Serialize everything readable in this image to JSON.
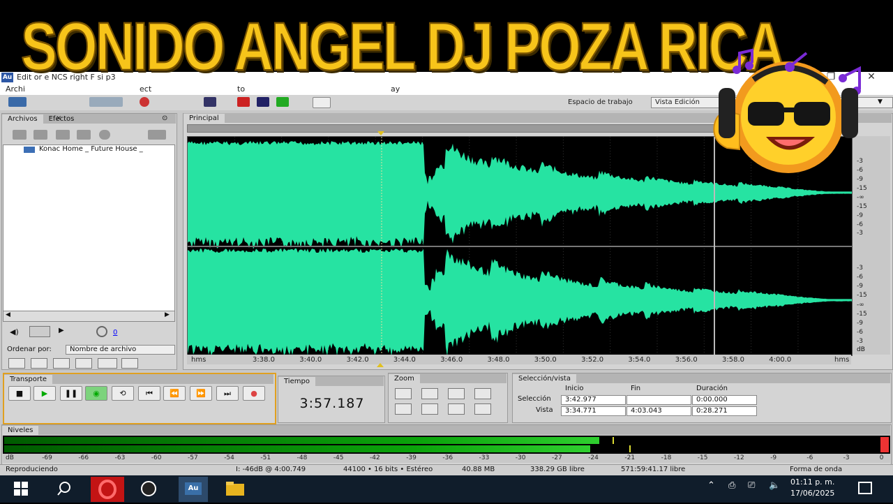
{
  "banner": {
    "title": "SONIDO ANGEL DJ POZA RICA"
  },
  "window": {
    "badge": "Au",
    "title": "Edit  or  e NCS  right F  si  p3",
    "close": "✕",
    "restore": "❐"
  },
  "menu": {
    "items": [
      "Archi",
      "ect",
      "to",
      "ay"
    ]
  },
  "toolbar": {
    "workspace_label": "Espacio de trabajo",
    "workspace_value": "Vista Edición"
  },
  "files_panel": {
    "tabs": [
      "Archivos",
      "Efectos"
    ],
    "file": "Konac   Home _ Future House _",
    "sort_label": "Ordenar por:",
    "sort_value": "Nombre de archivo",
    "volume_readout": "0"
  },
  "main_panel": {
    "tab": "Principal"
  },
  "ruler": {
    "ticks": [
      "hms",
      "3:38.0",
      "3:40.0",
      "3:42.0",
      "3:44.0",
      "3:46.0",
      "3:48.0",
      "3:50.0",
      "3:52.0",
      "3:54.0",
      "3:56.0",
      "3:58.0",
      "4:00.0",
      "hms"
    ]
  },
  "db_scale": {
    "top_channel": [
      "-3",
      "-6",
      "-9",
      "-15",
      "-∞",
      "-15",
      "-9",
      "-6",
      "-3"
    ],
    "bottom_channel": [
      "-3",
      "-6",
      "-9",
      "-15",
      "-∞",
      "-15",
      "-9",
      "-6",
      "-3"
    ],
    "footer": "dB"
  },
  "transport": {
    "title": "Transporte"
  },
  "time_panel": {
    "title": "Tiempo",
    "value": "3:57.187"
  },
  "zoom_panel": {
    "title": "Zoom"
  },
  "selection_panel": {
    "title": "Selección/vista",
    "col_start": "Inicio",
    "col_end": "Fin",
    "col_duration": "Duración",
    "row_selection": "Selección",
    "row_view": "Vista",
    "selection_start": "3:42.977",
    "selection_end": "",
    "selection_duration": "0:00.000",
    "view_start": "3:34.771",
    "view_end": "4:03.043",
    "view_duration": "0:28.271"
  },
  "levels": {
    "title": "Niveles",
    "scale": [
      "dB",
      "-69",
      "-66",
      "-63",
      "-60",
      "-57",
      "-54",
      "-51",
      "-48",
      "-45",
      "-42",
      "-39",
      "-36",
      "-33",
      "-30",
      "-27",
      "-24",
      "-21",
      "-18",
      "-15",
      "-12",
      "-9",
      "-6",
      "-3",
      "0"
    ],
    "level_top": 0.68,
    "level_bottom": 0.67
  },
  "status": {
    "state": "Reproduciendo",
    "cursor": "I: -46dB @   4:00.749",
    "format": "44100 • 16 bits • Estéreo",
    "size": "40.88 MB",
    "free": "338.29 GB libre",
    "free_time": "571:59:41.17 libre",
    "view_mode": "Forma de onda"
  },
  "taskbar": {
    "clock_time": "01:11 p. m.",
    "clock_date": "17/06/2025"
  },
  "colors": {
    "waveform": "#26e3a2",
    "banner": "#f7c41a",
    "levels": "#0ba30b",
    "taskbar": "#101d2b"
  }
}
